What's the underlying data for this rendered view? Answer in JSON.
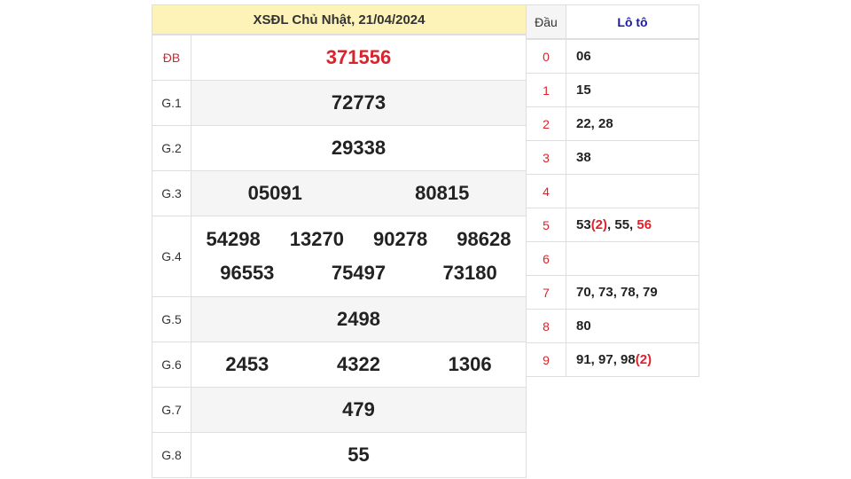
{
  "title": "XSĐL Chủ Nhật, 21/04/2024",
  "prizes": [
    {
      "label": "ĐB",
      "numbers": [
        "371556"
      ]
    },
    {
      "label": "G.1",
      "numbers": [
        "72773"
      ]
    },
    {
      "label": "G.2",
      "numbers": [
        "29338"
      ]
    },
    {
      "label": "G.3",
      "numbers": [
        "05091",
        "80815"
      ]
    },
    {
      "label": "G.4",
      "line1": [
        "54298",
        "13270",
        "90278",
        "98628"
      ],
      "line2": [
        "96553",
        "75497",
        "73180"
      ]
    },
    {
      "label": "G.5",
      "numbers": [
        "2498"
      ]
    },
    {
      "label": "G.6",
      "numbers": [
        "2453",
        "4322",
        "1306"
      ]
    },
    {
      "label": "G.7",
      "numbers": [
        "479"
      ]
    },
    {
      "label": "G.8",
      "numbers": [
        "55"
      ]
    }
  ],
  "loto": {
    "head_dau": "Đầu",
    "head_loto": "Lô tô",
    "rows": [
      {
        "d": "0",
        "v": "06"
      },
      {
        "d": "1",
        "v": "15"
      },
      {
        "d": "2",
        "v": "22, 28"
      },
      {
        "d": "3",
        "v": "38"
      },
      {
        "d": "4",
        "v": ""
      },
      {
        "d": "5",
        "v_a": "53",
        "v_b": "(2)",
        "v_c": ", 55, ",
        "v_d": "56"
      },
      {
        "d": "6",
        "v": ""
      },
      {
        "d": "7",
        "v": "70, 73, 78, 79"
      },
      {
        "d": "8",
        "v": "80"
      },
      {
        "d": "9",
        "v_a": "91, 97, 98",
        "v_b": "(2)"
      }
    ]
  },
  "colors": {
    "accent_red": "#d9232d",
    "title_bg": "#fdf2b8",
    "loto_header": "#1a1aa6"
  }
}
